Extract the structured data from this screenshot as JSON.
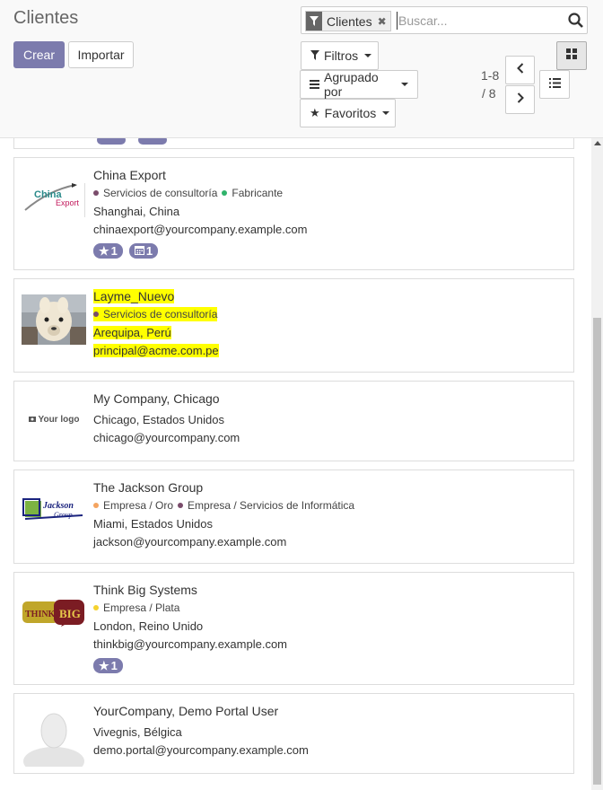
{
  "header": {
    "title": "Clientes",
    "create_label": "Crear",
    "import_label": "Importar"
  },
  "search": {
    "facet_value": "Clientes",
    "placeholder": "Buscar..."
  },
  "filters": {
    "filters_label": "Filtros",
    "groupby_label": "Agrupado por",
    "favorites_label": "Favoritos"
  },
  "pager": {
    "range": "1-8",
    "total": "/ 8"
  },
  "colors": {
    "primary": "#7c7bad",
    "highlight": "#ffff00"
  },
  "cards": [
    {
      "name": "China Export",
      "tags": [
        {
          "label": "Servicios de consultoría",
          "color": "#7a4c6b"
        },
        {
          "label": "Fabricante",
          "color": "#2fb36b"
        }
      ],
      "location": "Shanghai, China",
      "email": "chinaexport@yourcompany.example.com",
      "logo_text": [
        "China",
        "Export"
      ],
      "badges": [
        {
          "icon": "star-icon",
          "count": "1"
        },
        {
          "icon": "calendar-icon",
          "count": "1"
        }
      ]
    },
    {
      "name": "Layme_Nuevo",
      "tags": [
        {
          "label": "Servicios de consultoría",
          "color": "#7a4c6b"
        }
      ],
      "location": "Arequipa, Perú",
      "email": "principal@acme.com.pe",
      "image": "alpaca-photo"
    },
    {
      "name": "My Company, Chicago",
      "location": "Chicago, Estados Unidos",
      "email": "chicago@yourcompany.com",
      "logo_text": "Your logo"
    },
    {
      "name": "The Jackson Group",
      "tags": [
        {
          "label": "Empresa / Oro",
          "color": "#f4a460"
        },
        {
          "label": "Empresa / Servicios de Informática",
          "color": "#7a4c6b"
        }
      ],
      "location": "Miami, Estados Unidos",
      "email": "jackson@yourcompany.example.com",
      "logo_text": [
        "Jackson",
        "Group"
      ]
    },
    {
      "name": "Think Big Systems",
      "tags": [
        {
          "label": "Empresa / Plata",
          "color": "#f5d22e"
        }
      ],
      "location": "London, Reino Unido",
      "email": "thinkbig@yourcompany.example.com",
      "logo_text": [
        "THINK",
        "BIG"
      ],
      "badges": [
        {
          "icon": "star-icon",
          "count": "1"
        }
      ]
    },
    {
      "name": "YourCompany, Demo Portal User",
      "location": "Vivegnis, Bélgica",
      "email": "demo.portal@yourcompany.example.com",
      "image": "avatar-placeholder"
    }
  ]
}
